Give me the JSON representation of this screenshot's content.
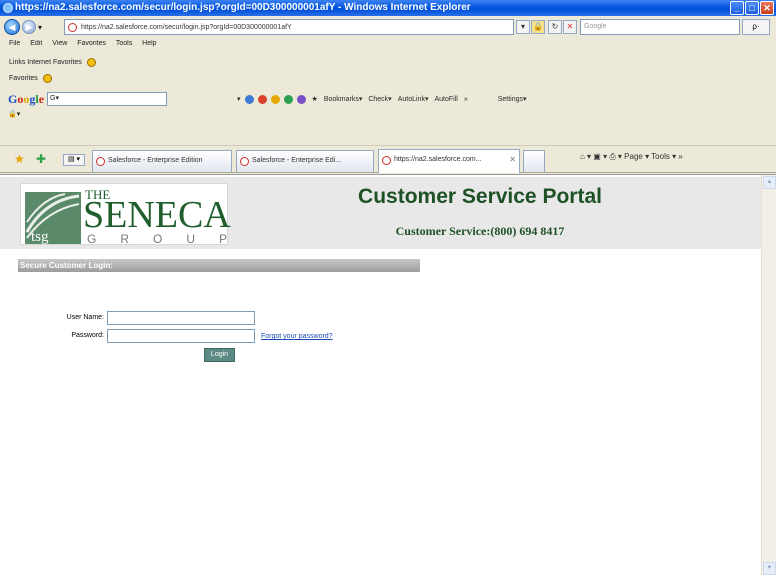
{
  "window": {
    "title": "https://na2.salesforce.com/secur/login.jsp?orgId=00D300000001afY - Windows Internet Explorer",
    "controls": {
      "minimize": "_",
      "maximize": "□",
      "close": "✕"
    }
  },
  "nav": {
    "back": "◀",
    "forward": "▶",
    "dropdown": "▾",
    "address": "https://na2.salesforce.com/secur/login.jsp?orgId=00D300000001afY",
    "search_placeholder": "Google",
    "search_go": "ρ·"
  },
  "menu": [
    "File",
    "Edit",
    "View",
    "Favorites",
    "Tools",
    "Help"
  ],
  "links_bar": {
    "label": "Links Internet Favorites"
  },
  "fav_bar": {
    "label": "Favorites"
  },
  "google_bar": {
    "logo_parts": [
      "G",
      "o",
      "o",
      "g",
      "l",
      "e"
    ],
    "input_value": "G▾",
    "bookmarks": "Bookmarks▾",
    "check": "Check▾",
    "autolink": "AutoLink▾",
    "autofill": "AutoFill",
    "more": "»",
    "settings": "Settings▾"
  },
  "extra_row": {
    "label": "🔒▾"
  },
  "tabs": [
    {
      "label": "Salesforce - Enterprise Edition",
      "active": false
    },
    {
      "label": "Salesforce - Enterprise Edi...",
      "active": false
    },
    {
      "label": "https://na2.salesforce.com...",
      "active": true
    }
  ],
  "tab_tools": "⌂ ▾  ▣ ▾  ⎙ ▾  Page ▾  Tools ▾  »",
  "quick_tabs": "▤ ▾",
  "scrollbar": {
    "up": "▲",
    "down": "▼"
  },
  "header": {
    "logo_the": "THE",
    "logo_name": "SENECA",
    "logo_group_letters": [
      "G",
      "R",
      "O",
      "U",
      "P"
    ],
    "logo_emblem_text": "tsg",
    "title": "Customer Service Portal",
    "phone": "Customer Service:(800) 694 8417"
  },
  "login": {
    "section_title": "Secure Customer Login:",
    "username_label": "User Name:",
    "username_value": "",
    "password_label": "Password:",
    "password_value": "",
    "forgot_link": "Forgot your password?",
    "login_button": "Login"
  }
}
